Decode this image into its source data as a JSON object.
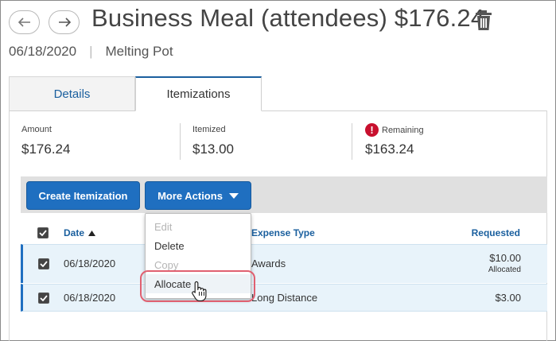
{
  "header": {
    "title": "Business Meal (attendees) $176.24",
    "date": "06/18/2020",
    "separator": "|",
    "vendor": "Melting Pot"
  },
  "tabs": [
    {
      "label": "Details",
      "active": false
    },
    {
      "label": "Itemizations",
      "active": true
    }
  ],
  "summary": {
    "amount_label": "Amount",
    "amount_value": "$176.24",
    "itemized_label": "Itemized",
    "itemized_value": "$13.00",
    "remaining_label": "Remaining",
    "remaining_value": "$163.24",
    "remaining_icon": "!"
  },
  "toolbar": {
    "create_label": "Create Itemization",
    "more_actions_label": "More Actions"
  },
  "table": {
    "columns": {
      "date": "Date",
      "expense_type": "Expense Type",
      "requested": "Requested"
    },
    "rows": [
      {
        "date": "06/18/2020",
        "expense_type": "Awards",
        "requested": "$10.00",
        "note": "Allocated"
      },
      {
        "date": "06/18/2020",
        "expense_type": "Long Distance",
        "requested": "$3.00"
      }
    ]
  },
  "dropdown": {
    "items": [
      {
        "label": "Edit",
        "enabled": false
      },
      {
        "label": "Delete",
        "enabled": true
      },
      {
        "label": "Copy",
        "enabled": false
      },
      {
        "label": "Allocate",
        "enabled": true,
        "hovered": true
      }
    ]
  },
  "colors": {
    "primary": "#1f6fc0",
    "link": "#1a5f9e",
    "error": "#c8102e",
    "highlight": "#e06070",
    "row_selected": "#e8f3fa"
  }
}
